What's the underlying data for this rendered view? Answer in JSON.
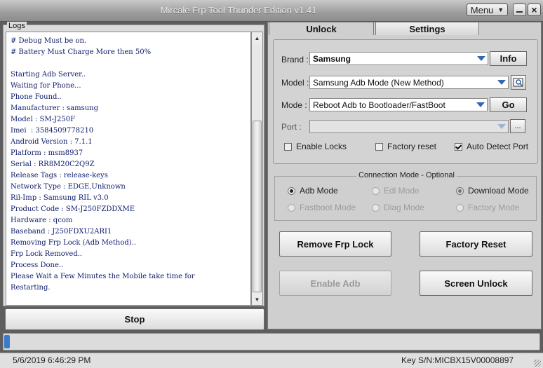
{
  "window": {
    "title": "Mircale Frp Tool Thunder Edition v1.41",
    "menu_label": "Menu"
  },
  "logs": {
    "caption": "Logs",
    "lines": [
      "# Debug Must be on.",
      "# Battery Must Charge More then 50%",
      "",
      "Starting Adb Server..",
      "Waiting for Phone...",
      "Phone Found..",
      "Manufacturer : samsung",
      "Model : SM-J250F",
      "Imei  : 3584509778210",
      "Android Version : 7.1.1",
      "Platform : msm8937",
      "Serial : RR8M20C2Q9Z",
      "Release Tags : release-keys",
      "Network Type : EDGE,Unknown",
      "Ril-Imp : Samsung RIL v3.0",
      "Product Code : SM-J250FZDDXME",
      "Hardware : qcom",
      "Baseband : J250FDXU2ARI1",
      "Removing Frp Lock (Adb Method)..",
      "Frp Lock Removed..",
      "Process Done..",
      "Please Wait a Few Minutes the Mobile take time for",
      "Restarting."
    ],
    "stop_label": "Stop"
  },
  "tabs": [
    {
      "label": "Unlock",
      "active": true
    },
    {
      "label": "Settings",
      "active": false
    }
  ],
  "unlock": {
    "brand": {
      "label": "Brand :",
      "value": "Samsung",
      "button": "Info"
    },
    "model": {
      "label": "Model :",
      "value": "Samsung Adb Mode (New Method)"
    },
    "mode": {
      "label": "Mode :",
      "value": "Reboot Adb to Bootloader/FastBoot",
      "button": "Go"
    },
    "port": {
      "label": "Port :",
      "value": "",
      "button": "..."
    },
    "checks": [
      {
        "label": "Enable Locks",
        "checked": false
      },
      {
        "label": "Factory reset",
        "checked": false
      },
      {
        "label": "Auto Detect Port",
        "checked": true
      }
    ]
  },
  "connection": {
    "caption": "Connection Mode - Optional",
    "options": [
      {
        "label": "Adb Mode",
        "selected": true,
        "enabled": true
      },
      {
        "label": "Edl Mode",
        "selected": false,
        "enabled": false
      },
      {
        "label": "Download Mode",
        "selected": false,
        "enabled": true
      },
      {
        "label": "Fastboot Mode",
        "selected": false,
        "enabled": false
      },
      {
        "label": "Diag Mode",
        "selected": false,
        "enabled": false
      },
      {
        "label": "Factory Mode",
        "selected": false,
        "enabled": false
      }
    ]
  },
  "actions": {
    "remove_frp": "Remove Frp Lock",
    "factory_reset": "Factory Reset",
    "enable_adb": "Enable Adb",
    "screen_unlock": "Screen Unlock"
  },
  "progress": {
    "percent": 1
  },
  "status": {
    "datetime": "5/6/2019 6:46:29 PM",
    "key": "Key S/N:MICBX15V00008897"
  },
  "colors": {
    "log_text": "#0d1b6b",
    "accent": "#3566b5",
    "progress": "#3b79c9"
  }
}
